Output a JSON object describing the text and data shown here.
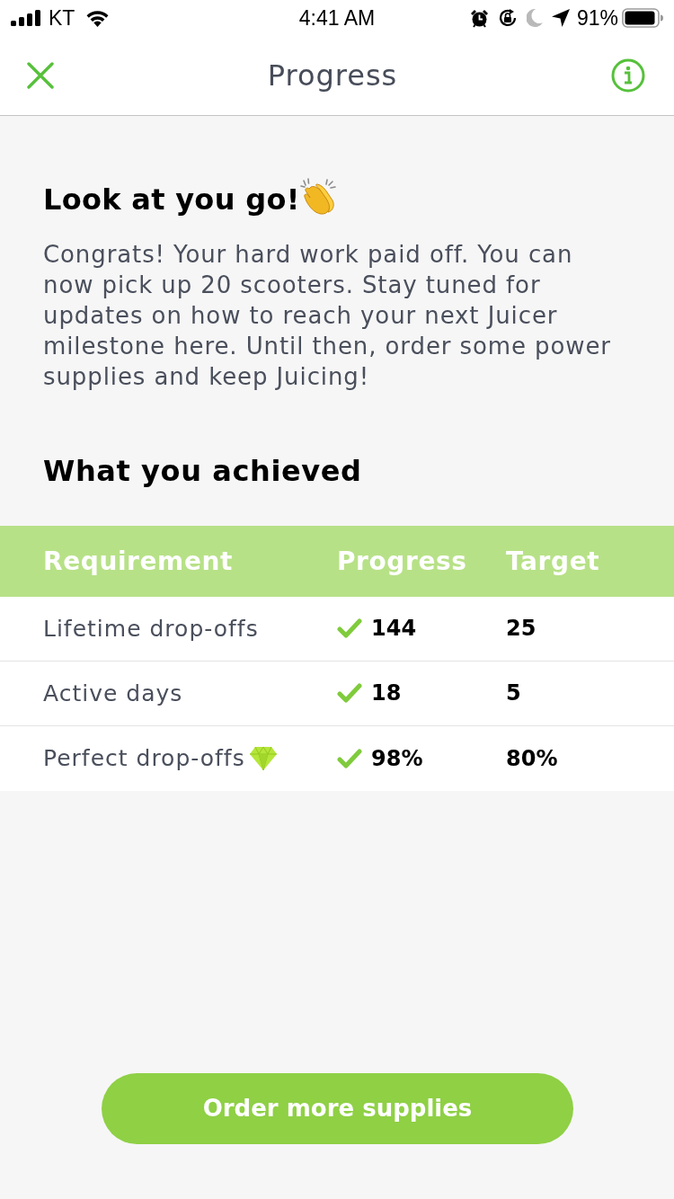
{
  "status_bar": {
    "carrier": "KT",
    "time": "4:41 AM",
    "battery": "91%"
  },
  "nav": {
    "title": "Progress"
  },
  "heading": "Look at you go!",
  "message": "Congrats! Your hard work paid off. You can now pick up 20 scooters. Stay tuned for updates on how to reach your next Juicer milestone here. Until then, order some power supplies and keep Juicing!",
  "section_title": "What you achieved",
  "table": {
    "columns": [
      "Requirement",
      "Progress",
      "Target"
    ],
    "rows": [
      {
        "kind": "plain",
        "requirement": "Lifetime drop-offs",
        "progress": "144",
        "target": "25",
        "met": true
      },
      {
        "kind": "plain",
        "requirement": "Active days",
        "progress": "18",
        "target": "5",
        "met": true
      },
      {
        "kind": "gem",
        "requirement": "Perfect drop-offs",
        "progress": "98%",
        "target": "80%",
        "met": true
      }
    ]
  },
  "button": "Order more supplies"
}
